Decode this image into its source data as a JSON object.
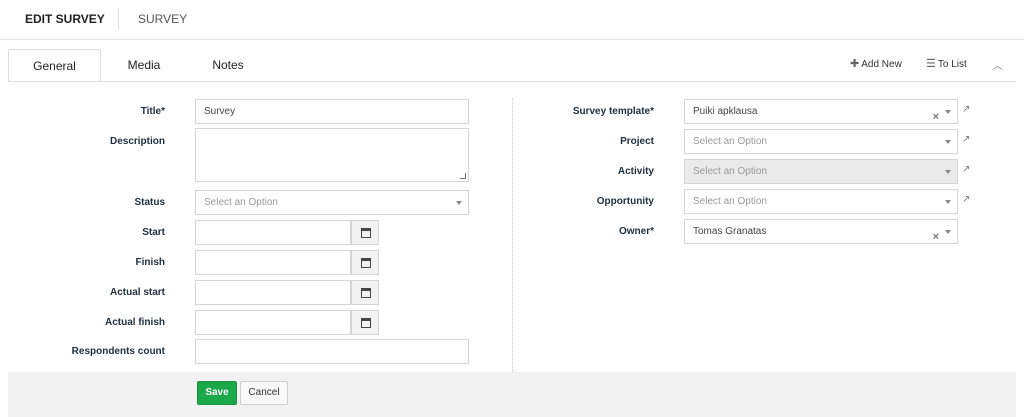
{
  "header": {
    "title": "EDIT SURVEY",
    "entity": "SURVEY"
  },
  "tabs": [
    {
      "label": "General",
      "active": true
    },
    {
      "label": "Media",
      "active": false
    },
    {
      "label": "Notes",
      "active": false
    }
  ],
  "toolbar": {
    "add_new": "Add New",
    "to_list": "To List"
  },
  "left_form": {
    "title": {
      "label": "Title",
      "required": "*",
      "value": "Survey"
    },
    "description": {
      "label": "Description",
      "value": ""
    },
    "status": {
      "label": "Status",
      "placeholder": "Select an Option"
    },
    "start": {
      "label": "Start",
      "value": ""
    },
    "finish": {
      "label": "Finish",
      "value": ""
    },
    "actual_start": {
      "label": "Actual start",
      "value": ""
    },
    "actual_finish": {
      "label": "Actual finish",
      "value": ""
    },
    "respondents_count": {
      "label": "Respondents count",
      "value": ""
    }
  },
  "right_form": {
    "survey_template": {
      "label": "Survey template",
      "required": "*",
      "value": "Puiki apklausa"
    },
    "project": {
      "label": "Project",
      "placeholder": "Select an Option"
    },
    "activity": {
      "label": "Activity",
      "placeholder": "Select an Option",
      "disabled": true
    },
    "opportunity": {
      "label": "Opportunity",
      "placeholder": "Select an Option"
    },
    "owner": {
      "label": "Owner",
      "required": "*",
      "value": "Tomas Granatas"
    }
  },
  "actions": {
    "save": "Save",
    "cancel": "Cancel"
  },
  "colors": {
    "save_bg": "#1aa84b",
    "label": "#1f2f3d",
    "footer_bg": "#f2f2f2"
  },
  "icons": [
    "plus-icon",
    "list-icon",
    "chevron-up-icon",
    "calendar-icon",
    "clear-icon",
    "caret-down-icon",
    "external-link-icon",
    "resize-handle-icon"
  ]
}
